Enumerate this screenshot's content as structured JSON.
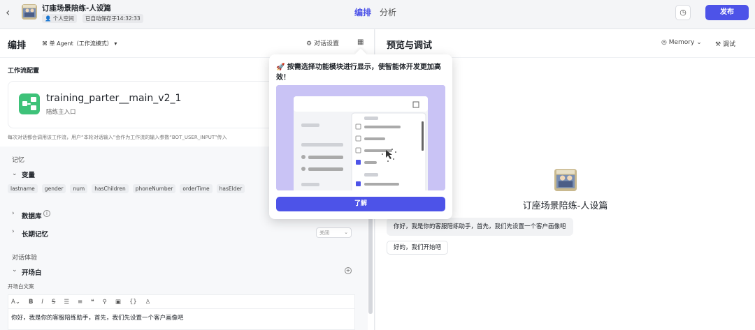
{
  "header": {
    "title": "订座场景陪练-人设篇",
    "space_tag": "个人空间",
    "autosave": "已自动保存于14:32:33",
    "tabs": [
      "编排",
      "分析"
    ],
    "publish": "发布"
  },
  "left": {
    "title": "编排",
    "agent_mode": "单 Agent（工作流模式）",
    "dialog_settings": "对话设置",
    "workflow_config": "工作流配置",
    "workflow_name": "training_parter__main_v2_1",
    "workflow_sub": "陪练主入口",
    "workflow_note": "每次对话都会调用该工作流，用户“本轮对话输入”会作为工作流的输入参数“BOT_USER_INPUT”传入",
    "memory": "记忆",
    "variables": "变量",
    "variable_chips": [
      "lastname",
      "gender",
      "num",
      "hasChildren",
      "phoneNumber",
      "orderTime",
      "hasElder"
    ],
    "database": "数据库",
    "long_memory": "长期记忆",
    "long_memory_value": "关闭",
    "dialog_experience": "对话体验",
    "opener": "开场白",
    "opener_copy": "开场白文案",
    "opener_text": "你好，我是你的客服陪练助手，首先，我们先设置一个客户画像吧"
  },
  "right": {
    "title": "预览与调试",
    "memory": "Memory",
    "debug": "调试",
    "bot_name": "订座场景陪练-人设篇",
    "bubble1": "你好，我是你的客服陪练助手，首先，我们先设置一个客户画像吧",
    "bubble2": "好的，我们开始吧"
  },
  "popover": {
    "text": "🚀 按需选择功能模块进行显示，使智能体开发更加高效！",
    "button": "了解"
  },
  "colors": {
    "accent": "#4d53e8",
    "workflow_icon": "#3ec279"
  }
}
